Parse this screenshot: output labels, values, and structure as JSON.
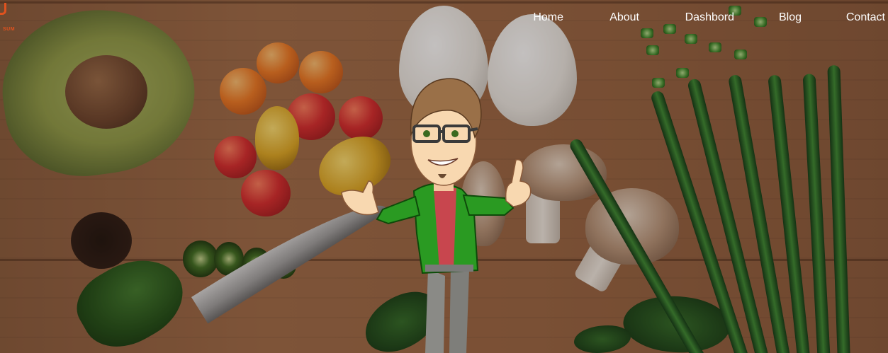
{
  "logo": {
    "text": "SUM",
    "color": "#e0521e"
  },
  "nav": {
    "items": [
      {
        "label": "Home"
      },
      {
        "label": "About"
      },
      {
        "label": "Dashbord"
      },
      {
        "label": "Blog"
      },
      {
        "label": "Contact"
      }
    ]
  },
  "hero": {
    "background": "wooden cutting board with avocado, tomatoes, eggs, mushrooms, peppers, spinach, green onions and knife",
    "character": "cartoon-man-thumbs-up"
  },
  "colors": {
    "nav_text": "#ffffff",
    "board": "#9a6440",
    "character_jacket": "#2a9a22",
    "character_shirt": "#c8464e"
  }
}
